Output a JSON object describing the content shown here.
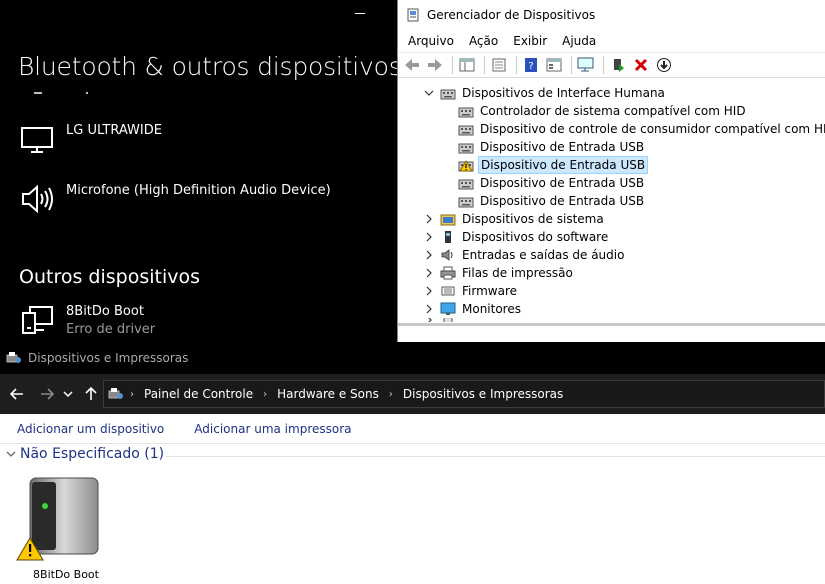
{
  "settings": {
    "title": "Bluetooth & outros dispositivos",
    "devices": [
      {
        "name": "LG ULTRAWIDE",
        "icon": "monitor-icon"
      },
      {
        "name": "Microfone (High Definition Audio Device)",
        "icon": "speaker-icon"
      }
    ],
    "other_section": "Outros dispositivos",
    "other_devices": [
      {
        "name": "8BitDo Boot",
        "status": "Erro de driver",
        "icon": "generic-device-icon"
      }
    ]
  },
  "device_manager": {
    "title": "Gerenciador de Dispositivos",
    "menu": [
      "Arquivo",
      "Ação",
      "Exibir",
      "Ajuda"
    ],
    "tree": {
      "hid_category": "Dispositivos de Interface Humana",
      "hid_children": [
        "Controlador de sistema compatível com HID",
        "Dispositivo de controle de consumidor compatível com HID",
        "Dispositivo de Entrada USB",
        "Dispositivo de Entrada USB",
        "Dispositivo de Entrada USB",
        "Dispositivo de Entrada USB"
      ],
      "selected_index": 3,
      "warning_index": 3,
      "categories": [
        "Dispositivos de sistema",
        "Dispositivos do software",
        "Entradas e saídas de áudio",
        "Filas de impressão",
        "Firmware",
        "Monitores"
      ]
    }
  },
  "devices_printers": {
    "title": "Dispositivos e Impressoras",
    "breadcrumb": [
      "Painel de Controle",
      "Hardware e Sons",
      "Dispositivos e Impressoras"
    ],
    "commands": [
      "Adicionar um dispositivo",
      "Adicionar uma impressora"
    ],
    "group_label": "Não Especificado (1)",
    "device": {
      "name": "8BitDo Boot",
      "status": "warning"
    }
  },
  "colors": {
    "link_blue": "#1e3287",
    "selection": "#cce8ff",
    "warning": "#ffc800",
    "delete_red": "#d40000"
  }
}
